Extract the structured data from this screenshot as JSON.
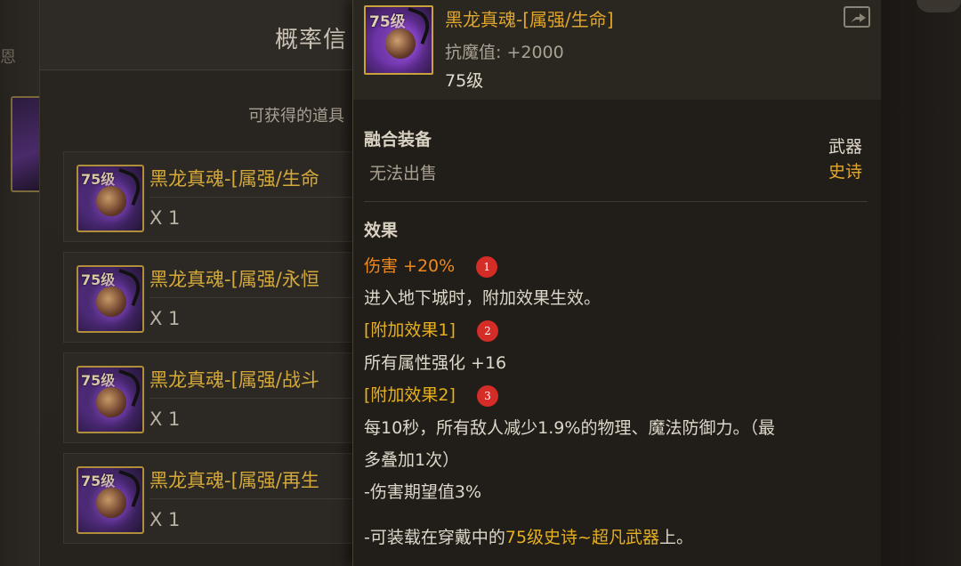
{
  "left_edge": {
    "text": "恩"
  },
  "probability_panel": {
    "title": "概率信",
    "subtitle": "可获得的道具",
    "items": [
      {
        "level": "75级",
        "name": "黑龙真魂-[属强/生命",
        "count": "X 1"
      },
      {
        "level": "75级",
        "name": "黑龙真魂-[属强/永恒",
        "count": "X 1"
      },
      {
        "level": "75级",
        "name": "黑龙真魂-[属强/战斗",
        "count": "X 1"
      },
      {
        "level": "75级",
        "name": "黑龙真魂-[属强/再生",
        "count": "X 1"
      }
    ]
  },
  "tooltip": {
    "icon_level": "75级",
    "name": "黑龙真魂-[属强/生命]",
    "resist": "抗魔值: +2000",
    "level": "75级",
    "equip_type": "融合装备",
    "sell": "无法出售",
    "slot": "武器",
    "rarity": "史诗",
    "effect_title": "效果",
    "damage_label": "伤害 +20%",
    "marker1": "1",
    "dungeon_line": "进入地下城时，附加效果生效。",
    "extra1_label": "[附加效果1]",
    "marker2": "2",
    "all_attr": "所有属性强化 +16",
    "extra2_label": "[附加效果2]",
    "marker3": "3",
    "every10_line1": "每10秒，所有敌人减少1.9%的物理、魔法防御力。（最",
    "every10_line2": "多叠加1次）",
    "expected": "-伤害期望值3%",
    "equip_prefix": "-可装载在穿戴中的",
    "equip_highlight": "75级史诗~超凡武器",
    "equip_suffix": "上。"
  },
  "colors": {
    "gold": "#e6b020",
    "orange": "#f08a1e",
    "marker_red": "#d42c26"
  }
}
